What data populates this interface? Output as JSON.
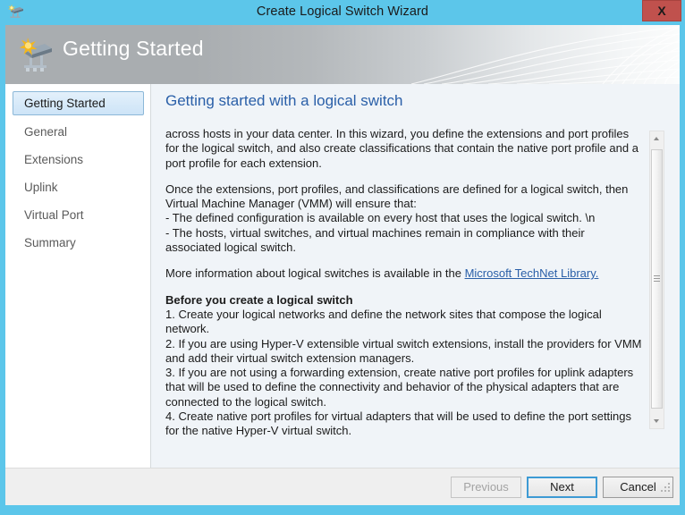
{
  "window": {
    "title": "Create Logical Switch Wizard",
    "title_icon": "logical-switch-icon",
    "close_label": "X",
    "accent_color": "#5cc6ea",
    "close_color": "#c0514d"
  },
  "banner": {
    "title": "Getting Started",
    "icon": "logical-switch-icon"
  },
  "sidebar": {
    "items": [
      {
        "label": "Getting Started",
        "selected": true
      },
      {
        "label": "General",
        "selected": false
      },
      {
        "label": "Extensions",
        "selected": false
      },
      {
        "label": "Uplink",
        "selected": false
      },
      {
        "label": "Virtual Port",
        "selected": false
      },
      {
        "label": "Summary",
        "selected": false
      }
    ]
  },
  "content": {
    "heading": "Getting started with a logical switch",
    "paragraph1": "across hosts in your data center. In this wizard, you define the extensions and port profiles for the logical switch, and also create classifications that contain the native port profile and a port profile for each extension.",
    "paragraph2": "Once the extensions, port profiles, and classifications are defined for a logical switch, then Virtual Machine Manager (VMM) will ensure that:\n- The defined configuration is available on every host that uses the logical switch. \\n\n- The hosts, virtual switches, and virtual machines remain in compliance with their associated logical switch.",
    "paragraph2_lines": [
      "Once the extensions, port profiles, and classifications are defined for a logical switch, then Virtual Machine Manager (VMM) will ensure that:",
      "- The defined configuration is available on every host that uses the logical switch. \\n",
      "- The hosts, virtual switches, and virtual machines remain in compliance with their associated logical switch."
    ],
    "more_info_prefix": "More information about logical switches is available in the ",
    "more_info_link": "Microsoft TechNet Library.",
    "before_heading": "Before you create a logical switch",
    "before_steps": [
      "1. Create your logical networks and define the network sites that compose the logical network.",
      "2. If you are using Hyper-V extensible virtual switch extensions, install the providers for VMM and add their virtual switch extension managers.",
      "3. If you are not using a forwarding extension, create native port profiles for uplink adapters that will be used to define the connectivity and behavior of the physical adapters that are connected to the logical switch.",
      "4. Create native port profiles for virtual adapters that will be used to define the port settings for the native Hyper-V virtual switch."
    ]
  },
  "scrollbar": {
    "up_icon": "chevron-up-icon",
    "down_icon": "chevron-down-icon"
  },
  "footer": {
    "previous_label": "Previous",
    "next_label": "Next",
    "cancel_label": "Cancel",
    "previous_enabled": false,
    "next_is_default": true
  }
}
